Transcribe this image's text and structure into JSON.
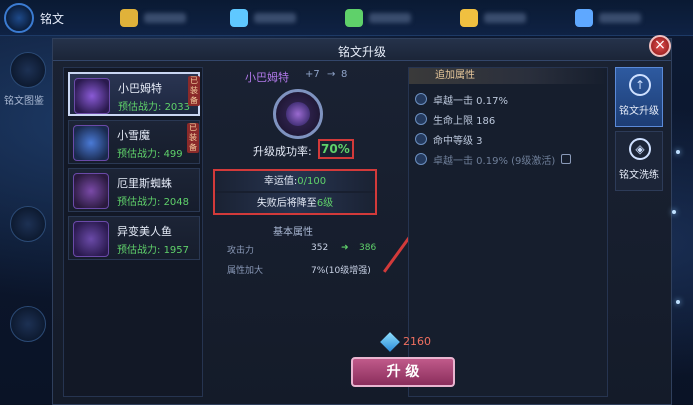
{
  "top_bar": {
    "title": "铭文",
    "resources": [
      {
        "icon": "gold-coin-icon",
        "color": "#e0b23a"
      },
      {
        "icon": "diamond-icon",
        "color": "#5fc8ff"
      },
      {
        "icon": "gem-icon",
        "color": "#5fd16a"
      },
      {
        "icon": "coupon-icon",
        "color": "#f0c040"
      },
      {
        "icon": "crystal-icon",
        "color": "#5fa8ff"
      }
    ]
  },
  "side_menu": {
    "item1_label": "铭文图鉴"
  },
  "panel": {
    "title": "铭文升级",
    "close_glyph": "×"
  },
  "inscriptions": [
    {
      "name": "小巴姆特",
      "power_label": "预估战力:",
      "power": "2033",
      "tag": "已装备",
      "selected": true,
      "color": "#8a5ad6"
    },
    {
      "name": "小雪魔",
      "power_label": "预估战力:",
      "power": "499",
      "tag": "已装备",
      "selected": false,
      "color": "#4a7ad6"
    },
    {
      "name": "厄里斯蜘蛛",
      "power_label": "预估战力:",
      "power": "2048",
      "tag": "",
      "selected": false,
      "color": "#7a4aa8"
    },
    {
      "name": "异变美人鱼",
      "power_label": "预估战力:",
      "power": "1957",
      "tag": "",
      "selected": false,
      "color": "#6a4aa8"
    }
  ],
  "upgrade": {
    "name": "小巴姆特",
    "level": "+7",
    "arrow": "→",
    "next_level": "8",
    "rate_label": "升级成功率:",
    "rate_value": "70%",
    "luck_label": "幸运值:",
    "luck_value": "0/100",
    "fail_label": "失败后将降至",
    "fail_value": "6级",
    "basic_title": "基本属性",
    "attrs": [
      {
        "name": "攻击力",
        "current": "352",
        "arrow": "➜",
        "next": "386"
      },
      {
        "name": "属性加大",
        "current": "7%(10级增强)",
        "arrow": "",
        "next": ""
      }
    ]
  },
  "extra_attrs": {
    "title": "追加属性",
    "items": [
      {
        "text": "卓越一击 0.17%",
        "active": true
      },
      {
        "text": "生命上限 186",
        "active": true
      },
      {
        "text": "命中等级 3",
        "active": true
      },
      {
        "text": "卓越一击 0.19% (9级激活)",
        "active": false
      }
    ]
  },
  "tabs": [
    {
      "label": "铭文升级",
      "glyph": "↑",
      "active": true
    },
    {
      "label": "铭文洗练",
      "glyph": "◈",
      "active": false
    }
  ],
  "bottom": {
    "gem_count": "2160",
    "upgrade_button": "升 级"
  }
}
